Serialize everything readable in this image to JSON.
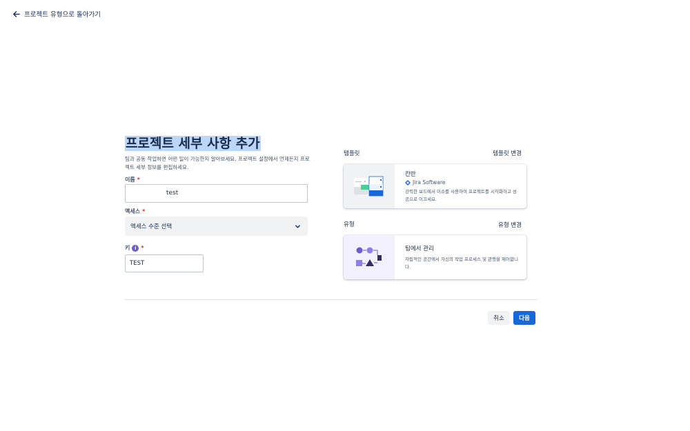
{
  "nav": {
    "back_label": "프로젝트 유형으로 돌아가기"
  },
  "form": {
    "title": "프로젝트 세부 사항 추가",
    "subtitle": "팀과 공동 작업하면 어떤 일이 가능한지 알아보세요. 프로젝트 설정에서 언제든지 프로젝트 세부 정보를 편집하세요.",
    "name": {
      "label": "이름",
      "required_mark": "*",
      "value": "test"
    },
    "access": {
      "label": "액세스",
      "required_mark": "*",
      "selected": "액세스 수준 선택"
    },
    "key": {
      "label": "키",
      "info_glyph": "i",
      "required_mark": "*",
      "value": "TEST"
    }
  },
  "template": {
    "section_label": "템플릿",
    "change_label": "템플릿 변경",
    "card": {
      "title": "칸반",
      "product": "Jira Software",
      "description": "강력한 보드에서 이슈를 사용하여 프로젝트를 시각화하고 성공으로 이끄세요."
    }
  },
  "type": {
    "section_label": "유형",
    "change_label": "유형 변경",
    "card": {
      "title": "팀에서 관리",
      "description": "자립적인 공간에서 자신의 작업 프로세스 및 관행을 제어합니다."
    }
  },
  "actions": {
    "cancel_label": "취소",
    "next_label": "다음"
  },
  "colors": {
    "primary": "#1868db",
    "title_highlight": "#bcd6f7",
    "required": "#c9372c",
    "info": "#6e5dc6"
  }
}
